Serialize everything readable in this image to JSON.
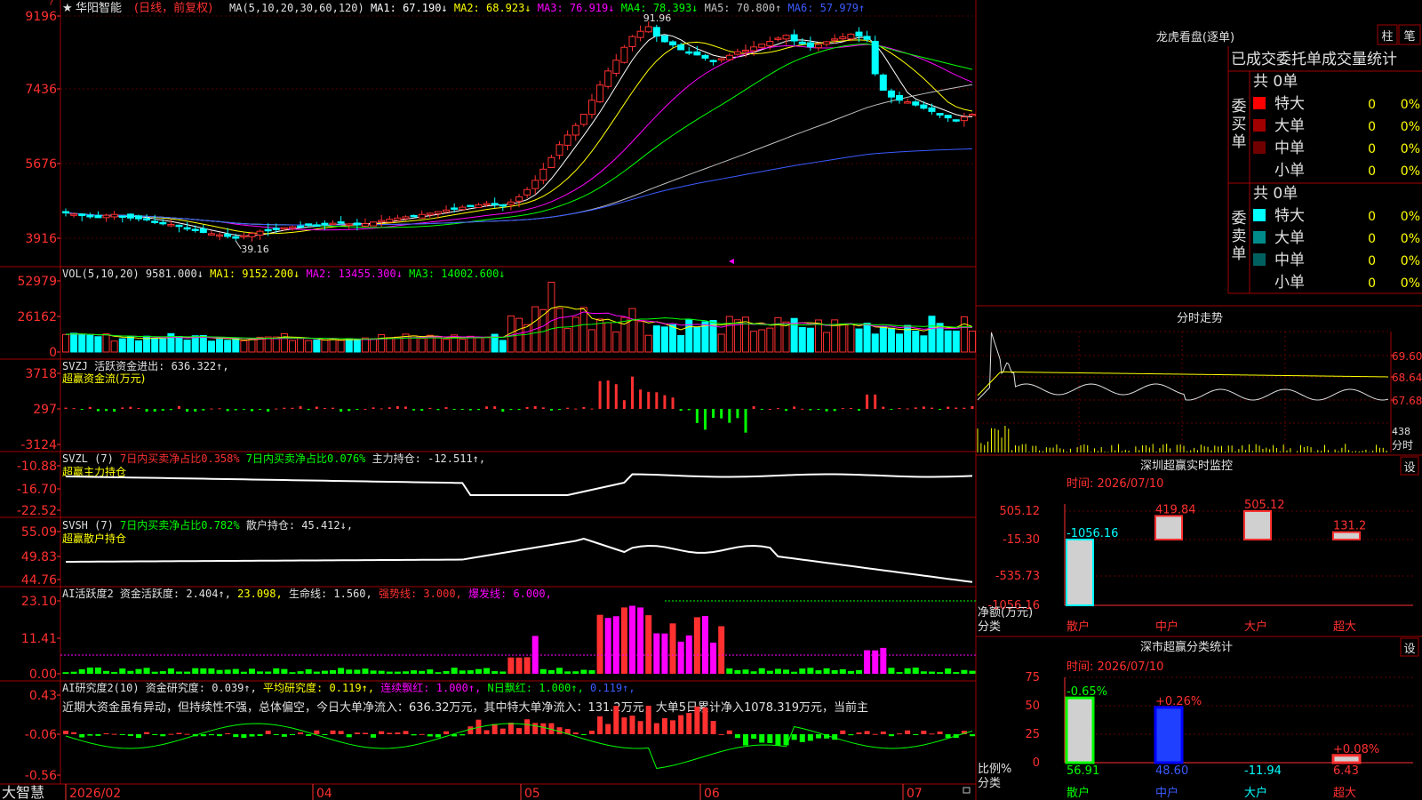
{
  "app": {
    "brand": "大智慧"
  },
  "kline": {
    "stock_name": "华阳智能",
    "mode": "(日线，前复权)",
    "ma_line": [
      {
        "label": "MA(5,10,20,30,60,120)",
        "color": "#e0e0e0"
      },
      {
        "label": "MA1: 67.190↓",
        "color": "#ffffff"
      },
      {
        "label": "MA2: 68.923↓",
        "color": "#ffff00"
      },
      {
        "label": "MA3: 76.919↓",
        "color": "#ff00ff"
      },
      {
        "label": "MA4: 78.393↓",
        "color": "#00ff00"
      },
      {
        "label": "MA5: 70.800↑",
        "color": "#c0c0c0"
      },
      {
        "label": "MA6: 57.979↑",
        "color": "#3b5bff"
      }
    ],
    "y_ticks": [
      "9196",
      "7436",
      "5676",
      "3916"
    ],
    "high_label": "91.96",
    "low_label": "39.16",
    "date_axis": [
      "2026/02",
      "04",
      "05",
      "06",
      "07"
    ]
  },
  "vol": {
    "legend": [
      {
        "label": "VOL(5,10,20)",
        "color": "#e0e0e0"
      },
      {
        "label": "9581.000↓",
        "color": "#e0e0e0"
      },
      {
        "label": "MA1: 9152.200↓",
        "color": "#ffff00"
      },
      {
        "label": "MA2: 13455.300↓",
        "color": "#ff00ff"
      },
      {
        "label": "MA3: 14002.600↓",
        "color": "#00ff00"
      }
    ],
    "y_ticks": [
      "52979",
      "26162",
      "0"
    ]
  },
  "svzj": {
    "legend": [
      {
        "label": "SVZJ  活跃资金进出: 636.322↑,",
        "color": "#e0e0e0"
      }
    ],
    "sub": "超赢资金流(万元)",
    "y_ticks": [
      "3718",
      "297",
      "-3124"
    ]
  },
  "svzl": {
    "legend": [
      {
        "label": "SVZL (7)",
        "color": "#e0e0e0"
      },
      {
        "label": "7日内买卖净占比0.358%",
        "color": "#ff3030"
      },
      {
        "label": "7日内买卖净占比0.076%",
        "color": "#00ff00"
      },
      {
        "label": "主力持仓: -12.511↑,",
        "color": "#e0e0e0"
      }
    ],
    "sub": "超赢主力持仓",
    "y_ticks": [
      "-10.88",
      "-16.70",
      "-22.52"
    ]
  },
  "svsh": {
    "legend": [
      {
        "label": "SVSH (7)",
        "color": "#e0e0e0"
      },
      {
        "label": "7日内买卖净占比0.782%",
        "color": "#00ff00"
      },
      {
        "label": "散户持仓: 45.412↓,",
        "color": "#e0e0e0"
      }
    ],
    "sub": "超赢散户持仓",
    "y_ticks": [
      "55.09",
      "49.83",
      "44.76"
    ]
  },
  "ai1": {
    "legend": [
      {
        "label": "AI活跃度2 资金活跃度: 2.404↑,",
        "color": "#e0e0e0"
      },
      {
        "label": "23.098,",
        "color": "#ffff00"
      },
      {
        "label": "生命线: 1.560,",
        "color": "#e0e0e0"
      },
      {
        "label": "强势线: 3.000,",
        "color": "#ff3030"
      },
      {
        "label": "爆发线: 6.000,",
        "color": "#ff00ff"
      }
    ],
    "y_ticks": [
      "23.10",
      "11.41",
      "0.00"
    ]
  },
  "ai2": {
    "legend": [
      {
        "label": "AI研究度2(10) 资金研究度: 0.039↑,",
        "color": "#e0e0e0"
      },
      {
        "label": "平均研究度: 0.119↑,",
        "color": "#ffff00"
      },
      {
        "label": "连续飘红: 1.000↑,",
        "color": "#ff00ff"
      },
      {
        "label": "N日飘红: 1.000↑,",
        "color": "#00ff00"
      },
      {
        "label": "0.119↑,",
        "color": "#3b5bff"
      }
    ],
    "text": "近期大资金虽有异动，但持续性不强，总体偏空，今日大单净流入：636.32万元，其中特大单净流入：131.2万元，大单5日累计净入1078.319万元，当前主",
    "y_ticks": [
      "0.43",
      "-0.06",
      "-0.56"
    ]
  },
  "lhb": {
    "title": "龙虎看盘(逐单)",
    "btn_bar": "柱",
    "btn_step": "笔",
    "tab_title": "已成交委托单成交量统计",
    "buy": {
      "total": "共 0单",
      "side": "委买单",
      "rows": [
        {
          "label": "特大",
          "count": "0",
          "pct": "0%",
          "color": "#ff0000"
        },
        {
          "label": "大单",
          "count": "0",
          "pct": "0%",
          "color": "#a00000"
        },
        {
          "label": "中单",
          "count": "0",
          "pct": "0%",
          "color": "#700000"
        },
        {
          "label": "小单",
          "count": "0",
          "pct": "0%",
          "color": ""
        }
      ]
    },
    "sell": {
      "total": "共 0单",
      "side": "委卖单",
      "rows": [
        {
          "label": "特大",
          "count": "0",
          "pct": "0%",
          "color": "#00ffff"
        },
        {
          "label": "大单",
          "count": "0",
          "pct": "0%",
          "color": "#008b8b"
        },
        {
          "label": "中单",
          "count": "0",
          "pct": "0%",
          "color": "#006060"
        },
        {
          "label": "小单",
          "count": "0",
          "pct": "0%",
          "color": ""
        }
      ]
    }
  },
  "intraday": {
    "title": "分时走势",
    "y_ticks": [
      "69.60",
      "68.64",
      "67.68"
    ],
    "vol_tick": "438",
    "vol_unit": "分时"
  },
  "monitor": {
    "title": "深圳超赢实时监控",
    "btn": "设",
    "time": "时间: 2026/07/10",
    "y_ticks": [
      "505.12",
      "-15.30",
      "-535.73",
      "-1056.16"
    ],
    "axis_label_1": "净额(万元)",
    "axis_label_2": "分类",
    "categories": [
      "散户",
      "中户",
      "大户",
      "超大"
    ],
    "values": [
      "-1056.16",
      "419.84",
      "505.12",
      "131.2"
    ]
  },
  "classify": {
    "title": "深市超赢分类统计",
    "btn": "设",
    "time": "时间: 2026/07/10",
    "y_ticks": [
      "75",
      "50",
      "25",
      "0"
    ],
    "axis_label_1": "比例%",
    "axis_label_2": "分类",
    "categories": [
      "散户",
      "中户",
      "大户",
      "超大"
    ],
    "top_labels": [
      "-0.65%",
      "+0.26%",
      "",
      "+0.08%"
    ],
    "bottom_labels": [
      "56.91",
      "48.60",
      "-11.94",
      "6.43"
    ]
  },
  "chart_data": [
    {
      "type": "candlestick",
      "title": "华阳智能(日线，前复权)",
      "ma_values": {
        "MA1": 67.19,
        "MA2": 68.923,
        "MA3": 76.919,
        "MA4": 78.393,
        "MA5": 70.8,
        "MA6": 57.979
      },
      "y_ticks": [
        9196,
        7436,
        5676,
        3916
      ],
      "high": 91.96,
      "low": 39.16,
      "x_labels": [
        "2026/02",
        "04",
        "05",
        "06",
        "07"
      ],
      "close_series": [
        45.5,
        45.2,
        44.8,
        44.5,
        44.3,
        44.9,
        45.1,
        44.6,
        44.2,
        44.0,
        43.8,
        43.4,
        42.9,
        42.6,
        42.1,
        41.7,
        41.2,
        40.6,
        40.3,
        40.0,
        39.6,
        39.16,
        39.8,
        40.4,
        40.9,
        41.2,
        41.5,
        41.8,
        42.0,
        42.2,
        42.4,
        42.3,
        42.6,
        42.9,
        43.1,
        42.7,
        42.5,
        42.8,
        43.2,
        43.6,
        43.9,
        44.2,
        44.5,
        44.8,
        45.1,
        45.4,
        45.8,
        46.2,
        46.6,
        46.9,
        47.2,
        47.5,
        47.8,
        47.6,
        47.4,
        48.2,
        49.5,
        51.3,
        53.6,
        56.4,
        59.3,
        62.5,
        64.9,
        67.3,
        70.1,
        73.6,
        77.4,
        80.9,
        83.6,
        86.8,
        89.5,
        90.8,
        91.96,
        89.6,
        88.2,
        87.4,
        86.2,
        85.6,
        84.9,
        84.1,
        83.4,
        84.0,
        84.8,
        85.7,
        86.1,
        86.9,
        87.6,
        88.3,
        89.1,
        89.8,
        88.4,
        87.7,
        86.9,
        87.5,
        88.2,
        88.9,
        89.4,
        90.1,
        89.6,
        88.8,
        80.2,
        76.1,
        74.4,
        73.6,
        73.2,
        72.4,
        71.6,
        70.8,
        69.9,
        69.2,
        68.6,
        69.4,
        70.1
      ]
    },
    {
      "type": "bar",
      "title": "VOL(5,10,20)",
      "y_ticks": [
        52979,
        26162,
        0
      ],
      "ma": {
        "MA1": 9152.2,
        "MA2": 13455.3,
        "MA3": 14002.6
      },
      "last": 9581.0
    },
    {
      "type": "bar",
      "title": "深圳超赢实时监控",
      "categories": [
        "散户",
        "中户",
        "大户",
        "超大"
      ],
      "values": [
        -1056.16,
        419.84,
        505.12,
        131.2
      ],
      "ylim": [
        -1056.16,
        505.12
      ]
    },
    {
      "type": "bar",
      "title": "深市超赢分类统计",
      "categories": [
        "散户",
        "中户",
        "大户",
        "超大"
      ],
      "values": [
        56.91,
        48.6,
        -11.94,
        6.43
      ],
      "change": [
        -0.65,
        0.26,
        null,
        0.08
      ],
      "ylim": [
        0,
        75
      ]
    }
  ]
}
